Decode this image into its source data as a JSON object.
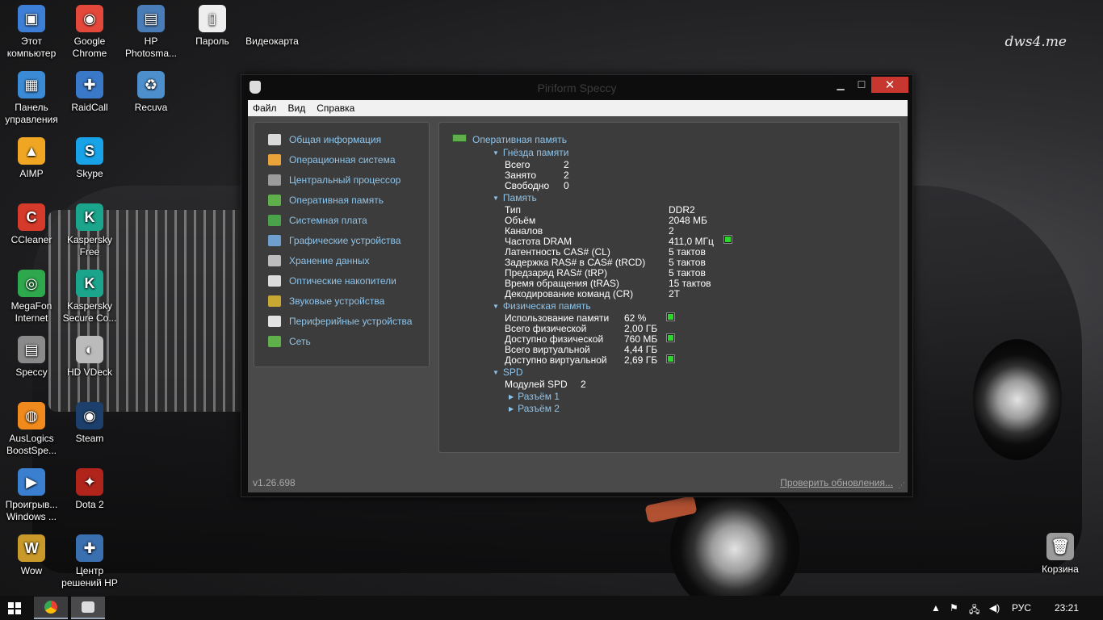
{
  "desktop": {
    "watermark": "dws4.me",
    "icons": [
      {
        "label": "Этот\nкомпьютер",
        "name": "this-pc-icon"
      },
      {
        "label": "Google\nChrome",
        "name": "chrome-icon"
      },
      {
        "label": "HP\nPhotosma...",
        "name": "hp-photosmart-icon"
      },
      {
        "label": "Пароль",
        "name": "password-file-icon"
      },
      {
        "label": "Видеокарта",
        "name": "videocard-file-icon"
      },
      {
        "label": "Панель\nуправления",
        "name": "control-panel-icon"
      },
      {
        "label": "RaidCall",
        "name": "raidcall-icon"
      },
      {
        "label": "Recuva",
        "name": "recuva-icon"
      },
      {
        "label": "AIMP",
        "name": "aimp-icon"
      },
      {
        "label": "Skype",
        "name": "skype-icon"
      },
      {
        "label": "CCleaner",
        "name": "ccleaner-icon"
      },
      {
        "label": "Kaspersky\nFree",
        "name": "kaspersky-free-icon"
      },
      {
        "label": "MegaFon\nInternet",
        "name": "megafon-icon"
      },
      {
        "label": "Kaspersky\nSecure Co...",
        "name": "kaspersky-secure-icon"
      },
      {
        "label": "Speccy",
        "name": "speccy-icon"
      },
      {
        "label": "HD VDeck",
        "name": "hd-vdeck-icon"
      },
      {
        "label": "AusLogics\nBoostSpe...",
        "name": "auslogics-icon"
      },
      {
        "label": "Steam",
        "name": "steam-icon"
      },
      {
        "label": "Проигрыв...\nWindows ...",
        "name": "windows-player-icon"
      },
      {
        "label": "Dota 2",
        "name": "dota2-icon"
      },
      {
        "label": "Wow",
        "name": "wow-icon"
      },
      {
        "label": "Центр\nрешений HP",
        "name": "hp-center-icon"
      },
      {
        "label": "Корзина",
        "name": "recycle-bin-icon"
      }
    ]
  },
  "window": {
    "title": "Piriform Speccy",
    "menu": [
      "Файл",
      "Вид",
      "Справка"
    ],
    "sidebar": [
      {
        "label": "Общая информация",
        "icon": "summary-icon",
        "color": "#d9d9d9"
      },
      {
        "label": "Операционная система",
        "icon": "windows-logo-icon",
        "color": "#e8a33a"
      },
      {
        "label": "Центральный процессор",
        "icon": "cpu-icon",
        "color": "#9b9b9b"
      },
      {
        "label": "Оперативная память",
        "icon": "ram-icon",
        "color": "#5fb04a"
      },
      {
        "label": "Системная плата",
        "icon": "motherboard-icon",
        "color": "#4aa34a"
      },
      {
        "label": "Графические устройства",
        "icon": "monitor-icon",
        "color": "#6f9fcf"
      },
      {
        "label": "Хранение данных",
        "icon": "hdd-icon",
        "color": "#bdbdbd"
      },
      {
        "label": "Оптические накопители",
        "icon": "disc-icon",
        "color": "#dcdcdc"
      },
      {
        "label": "Звуковые устройства",
        "icon": "speaker-icon",
        "color": "#c9a733"
      },
      {
        "label": "Периферийные устройства",
        "icon": "mouse-icon",
        "color": "#e3e3e3"
      },
      {
        "label": "Сеть",
        "icon": "network-icon",
        "color": "#5fb04a"
      }
    ],
    "main": {
      "heading": "Оперативная память",
      "slots": {
        "title": "Гнёзда памяти",
        "rows": [
          [
            "Всего",
            "2"
          ],
          [
            "Занято",
            "2"
          ],
          [
            "Свободно",
            "0"
          ]
        ]
      },
      "memory": {
        "title": "Память",
        "rows": [
          [
            "Тип",
            "DDR2"
          ],
          [
            "Объём",
            "2048 МБ"
          ],
          [
            "Каналов",
            "2"
          ],
          [
            "Частота DRAM",
            "411,0 МГц"
          ],
          [
            "Латентность CAS# (CL)",
            "5 тактов"
          ],
          [
            "Задержка RAS# в CAS# (tRCD)",
            "5 тактов"
          ],
          [
            "Предзаряд RAS# (tRP)",
            "5 тактов"
          ],
          [
            "Время обращения (tRAS)",
            "15 тактов"
          ],
          [
            "Декодирование команд (CR)",
            "2T"
          ]
        ]
      },
      "physical": {
        "title": "Физическая память",
        "rows": [
          [
            "Использование памяти",
            "62 %"
          ],
          [
            "Всего физической",
            "2,00 ГБ"
          ],
          [
            "Доступно физической",
            "760 МБ"
          ],
          [
            "Всего виртуальной",
            "4,44 ГБ"
          ],
          [
            "Доступно виртуальной",
            "2,69 ГБ"
          ]
        ]
      },
      "spd": {
        "title": "SPD",
        "modules_label": "Модулей SPD",
        "modules_value": "2",
        "slots": [
          "Разъём 1",
          "Разъём 2"
        ]
      }
    },
    "version": "v1.26.698",
    "update_link": "Проверить обновления..."
  },
  "taskbar": {
    "language": "РУС",
    "time": "23:21"
  }
}
